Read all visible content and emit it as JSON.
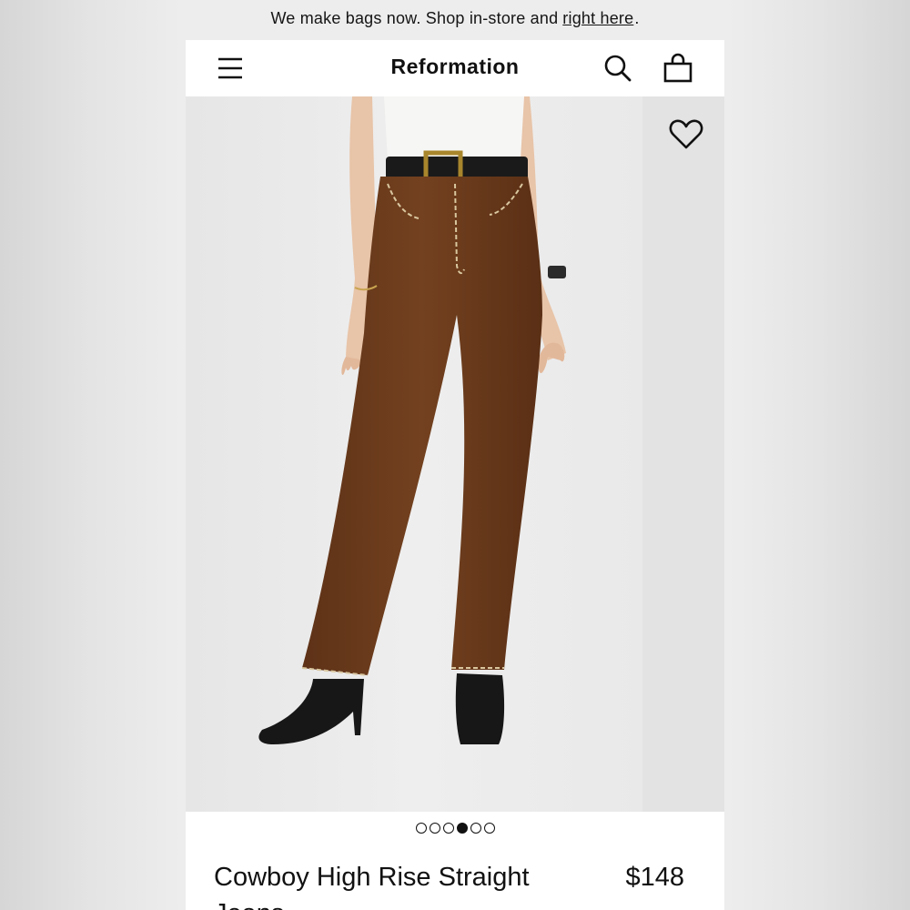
{
  "announcement": {
    "text": "We make bags now. Shop in-store and",
    "link_text": "right here",
    "suffix": "."
  },
  "header": {
    "logo": "Reformation",
    "icons": [
      "menu-icon",
      "search-icon",
      "shopping-bag-icon"
    ]
  },
  "gallery": {
    "wishlist_icon": "heart-icon",
    "image_count": 6,
    "active_index": 3
  },
  "product": {
    "title": "Cowboy High Rise Straight Jeans",
    "price": "$148"
  },
  "colors": {
    "pants": "#6b3a1a",
    "background": "#ebebeb",
    "text": "#111111"
  }
}
